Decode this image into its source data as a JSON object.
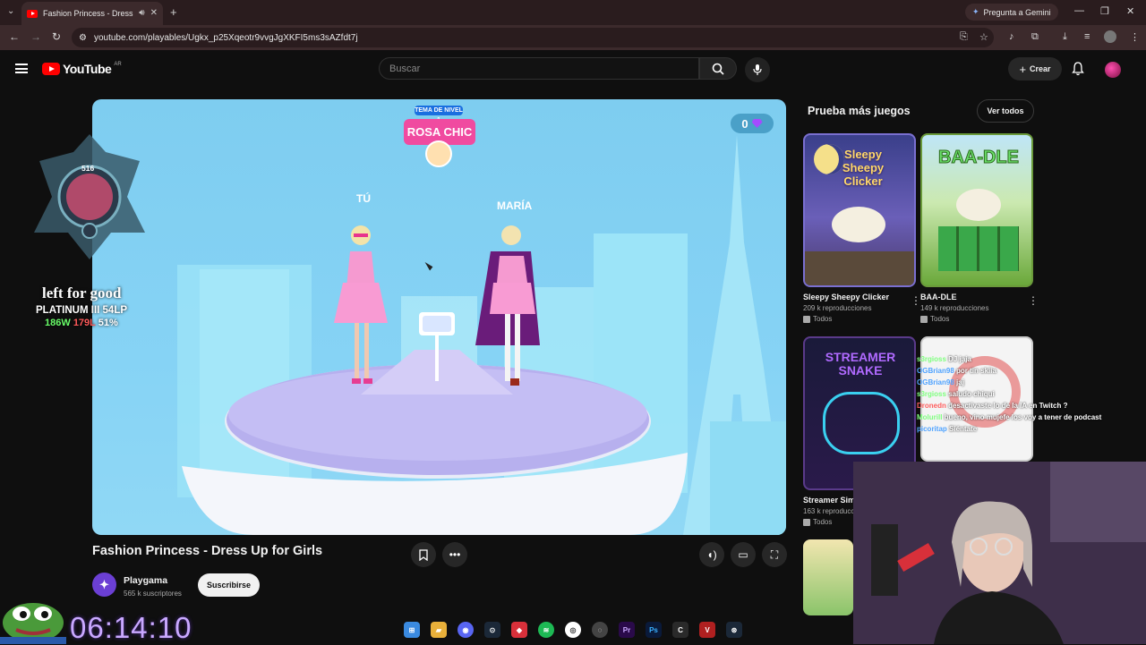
{
  "browser": {
    "tab_title": "Fashion Princess - Dress Up",
    "gemini_label": "Pregunta a Gemini",
    "url": "youtube.com/playables/Ugkx_p25Xqeotr9vvgJgXKFI5ms3sAZfdt7j"
  },
  "masthead": {
    "logo_text": "YouTube",
    "region": "AR",
    "search_placeholder": "Buscar",
    "create_label": "Crear"
  },
  "game": {
    "gem_count": "0",
    "level_label": "TEMA DE NIVEL 1",
    "theme_name": "ROSA CHIC",
    "player_you": "TÚ",
    "player_opponent": "MARÍA"
  },
  "video": {
    "title": "Fashion Princess - Dress Up for Girls",
    "channel_name": "Playgama",
    "channel_subs": "565 k suscriptores",
    "subscribe_label": "Suscribirse"
  },
  "sidebar": {
    "heading": "Prueba más juegos",
    "view_all": "Ver todos",
    "cards": [
      {
        "title": "Sleepy Sheepy Clicker",
        "views": "209 k reproducciones",
        "tag": "Todos",
        "thumb_text": "Sleepy Sheepy Clicker"
      },
      {
        "title": "BAA-DLE",
        "views": "149 k reproducciones",
        "tag": "Todos",
        "thumb_text": "BAA-DLE"
      },
      {
        "title": "Streamer Sim",
        "views": "163 k reproducc",
        "tag": "Todos",
        "thumb_text": "STREAMER SNAKE"
      }
    ]
  },
  "overlay": {
    "rank_level": "516",
    "rank_line_1": "left for good",
    "rank_line_2": "PLATINUM III 54LP",
    "rank_wins": "186W",
    "rank_losses": "179L",
    "rank_pct": "51%",
    "timer": "06:14:10",
    "chat": [
      {
        "user": "s3rgioss",
        "msg": "DJ jaja",
        "color": "#7fff7f"
      },
      {
        "user": "OGBrian98",
        "msg": "por tin skiia",
        "color": "#4fa3ff"
      },
      {
        "user": "OGBrian98",
        "msg": "jaj",
        "color": "#4fa3ff"
      },
      {
        "user": "s3rgioss",
        "msg": "saludo chiqui",
        "color": "#7fff7f"
      },
      {
        "user": "Dronedn",
        "msg": "desactivaste lo de la IA en Twitch ?",
        "color": "#ff5f5f"
      },
      {
        "user": "Molurill",
        "msg": "bueno, vino mujefe los voy a tener de podcast",
        "color": "#7fff7f"
      },
      {
        "user": "picoritap",
        "msg": "Siéntate",
        "color": "#4fa3ff"
      }
    ]
  },
  "colors": {
    "yt_red": "#ff0000",
    "theme_pink": "#f04ba0",
    "timer_purple": "#c9a8ff"
  }
}
